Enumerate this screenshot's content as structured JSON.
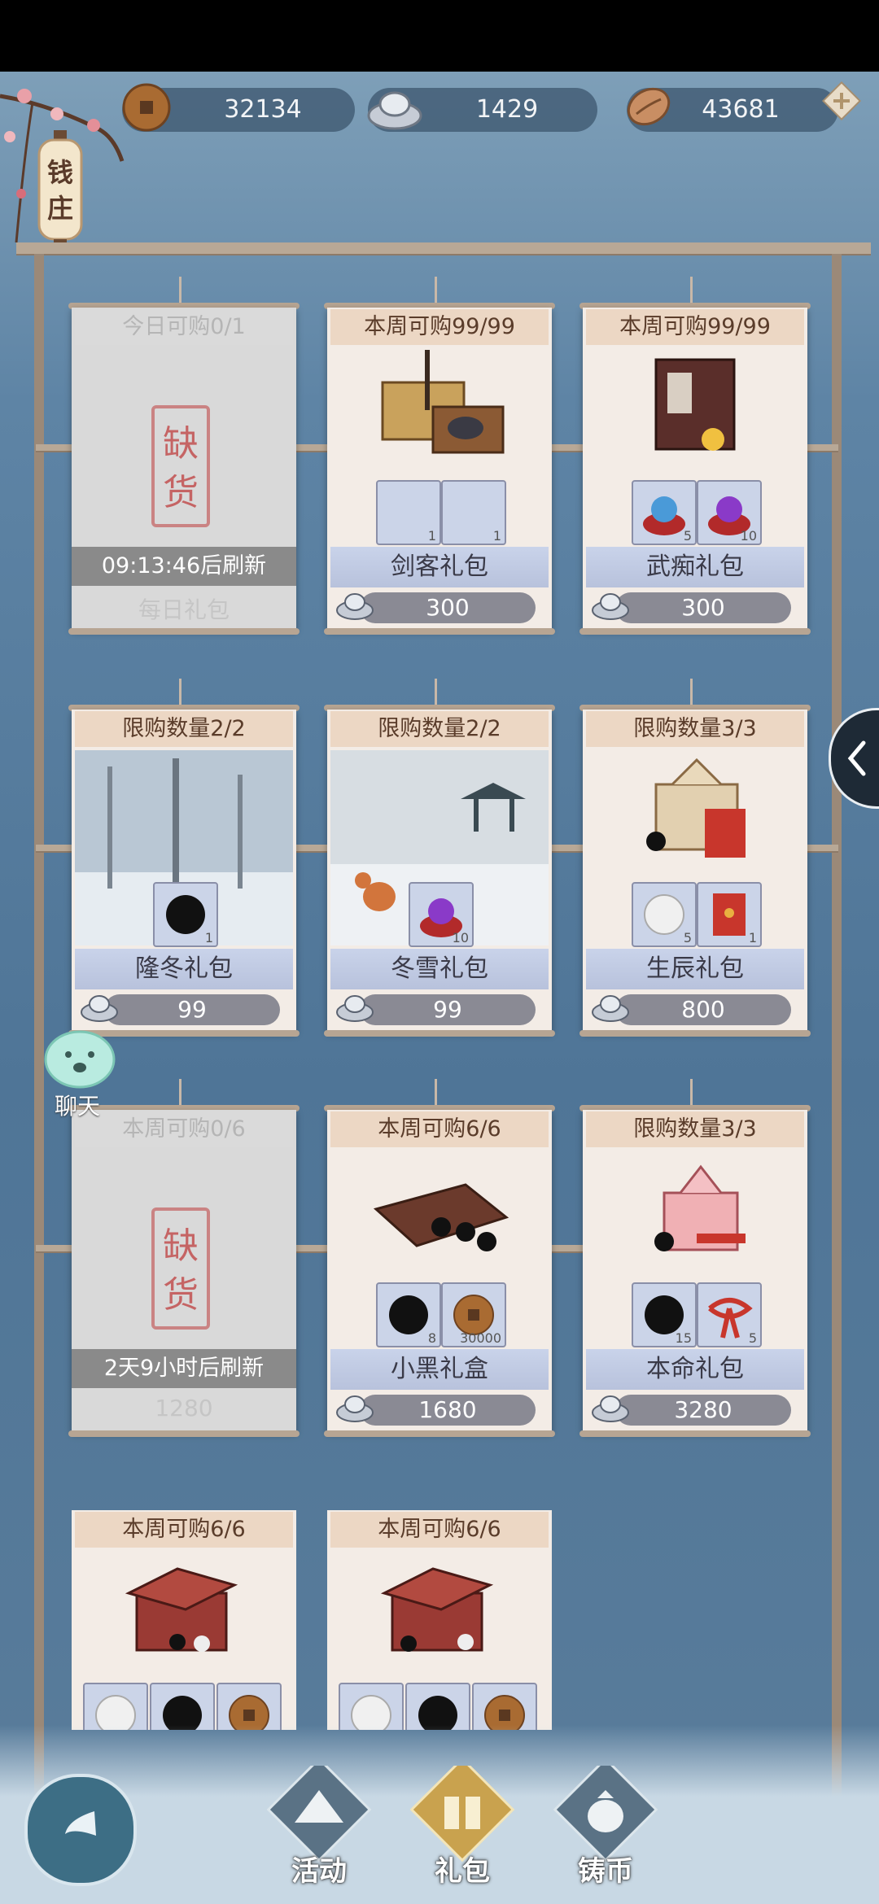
{
  "currency": [
    {
      "name": "copper-coin",
      "value": "32134"
    },
    {
      "name": "silver-ingot",
      "value": "1429"
    },
    {
      "name": "shell",
      "value": "43681"
    }
  ],
  "lantern_text": "钱庄",
  "side_chat_label": "聊天",
  "cards": [
    {
      "limit": "今日可购0/1",
      "soldout": true,
      "stamp": "缺货",
      "refresh": "09:13:46后刷新",
      "name": "每日礼包",
      "price": ""
    },
    {
      "limit": "本周可购99/99",
      "soldout": false,
      "name": "剑客礼包",
      "price": "300",
      "items": [
        {
          "icon": "chest-icon",
          "count": "1"
        },
        {
          "icon": "box-icon",
          "count": "1"
        }
      ]
    },
    {
      "limit": "本周可购99/99",
      "soldout": false,
      "name": "武痴礼包",
      "price": "300",
      "items": [
        {
          "icon": "blue-orb-icon",
          "count": "5"
        },
        {
          "icon": "purple-orb-icon",
          "count": "10"
        }
      ]
    },
    {
      "limit": "限购数量2/2",
      "soldout": false,
      "name": "隆冬礼包",
      "price": "99",
      "items": [
        {
          "icon": "black-stone-icon",
          "count": "1"
        }
      ]
    },
    {
      "limit": "限购数量2/2",
      "soldout": false,
      "name": "冬雪礼包",
      "price": "99",
      "items": [
        {
          "icon": "purple-orb-icon",
          "count": "10"
        }
      ]
    },
    {
      "limit": "限购数量3/3",
      "soldout": false,
      "name": "生辰礼包",
      "price": "800",
      "items": [
        {
          "icon": "white-stone-icon",
          "count": "5"
        },
        {
          "icon": "red-envelope-icon",
          "count": "1"
        }
      ]
    },
    {
      "limit": "本周可购0/6",
      "soldout": true,
      "stamp": "缺货",
      "refresh": "2天9小时后刷新",
      "name": "",
      "price": "1280"
    },
    {
      "limit": "本周可购6/6",
      "soldout": false,
      "name": "小黑礼盒",
      "price": "1680",
      "items": [
        {
          "icon": "black-stone-icon",
          "count": "8"
        },
        {
          "icon": "copper-coin-icon",
          "count": "30000"
        }
      ]
    },
    {
      "limit": "限购数量3/3",
      "soldout": false,
      "name": "本命礼包",
      "price": "3280",
      "items": [
        {
          "icon": "black-stone-icon",
          "count": "15"
        },
        {
          "icon": "red-ribbon-icon",
          "count": "5"
        }
      ]
    },
    {
      "limit": "本周可购6/6",
      "soldout": false,
      "name": "",
      "price": "",
      "items": [
        {
          "icon": "white-stone-icon",
          "count": ""
        },
        {
          "icon": "black-stone-icon",
          "count": ""
        },
        {
          "icon": "copper-coin-icon",
          "count": ""
        }
      ]
    },
    {
      "limit": "本周可购6/6",
      "soldout": false,
      "name": "",
      "price": "",
      "items": [
        {
          "icon": "white-stone-icon",
          "count": ""
        },
        {
          "icon": "black-stone-icon",
          "count": ""
        },
        {
          "icon": "copper-coin-icon",
          "count": ""
        }
      ]
    }
  ],
  "nav": [
    {
      "label": "活动"
    },
    {
      "label": "礼包"
    },
    {
      "label": "铸币"
    }
  ]
}
